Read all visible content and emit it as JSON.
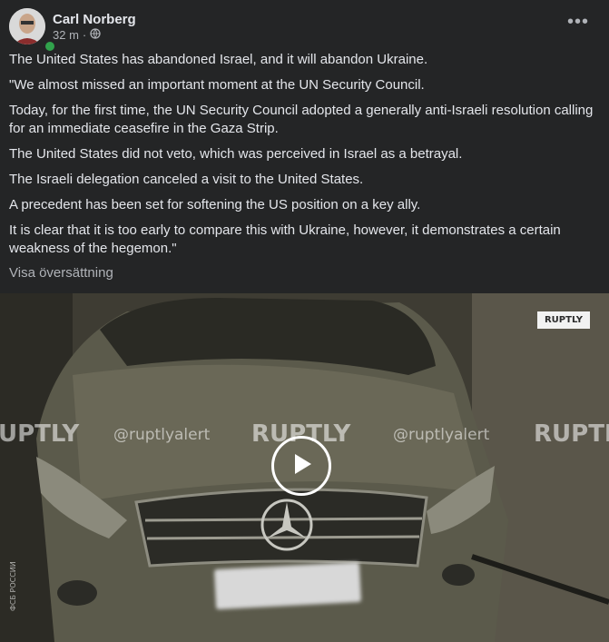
{
  "post": {
    "author": "Carl Norberg",
    "time": "32 m",
    "separator": "·",
    "privacy_icon": "globe-icon",
    "more_icon": "more-options-icon",
    "more_label": "•••",
    "paragraphs": [
      "The United States has abandoned Israel, and it will abandon Ukraine.",
      "\"We almost missed an important moment at the UN Security Council.",
      "Today, for the first time, the UN Security Council adopted a generally anti-Israeli resolution calling for an immediate ceasefire in the Gaza Strip.",
      "The United States did not veto, which was perceived in Israel as a betrayal.",
      "The Israeli delegation canceled a visit to the United States.",
      "A precedent has been set for softening the US position on a key ally.",
      "It is clear that it is too early to compare this with Ukraine, however, it demonstrates a certain weakness of the hegemon.\""
    ],
    "translate_label": "Visa översättning"
  },
  "video": {
    "badge": "RUPTLY",
    "watermarks": [
      "RUPTLY",
      "@ruptlyalert",
      "RUPTLY",
      "@ruptlyalert",
      "RUPTL",
      "UPTLY"
    ],
    "side_text": "ФСБ РОССИИ",
    "play_icon": "play-icon"
  }
}
